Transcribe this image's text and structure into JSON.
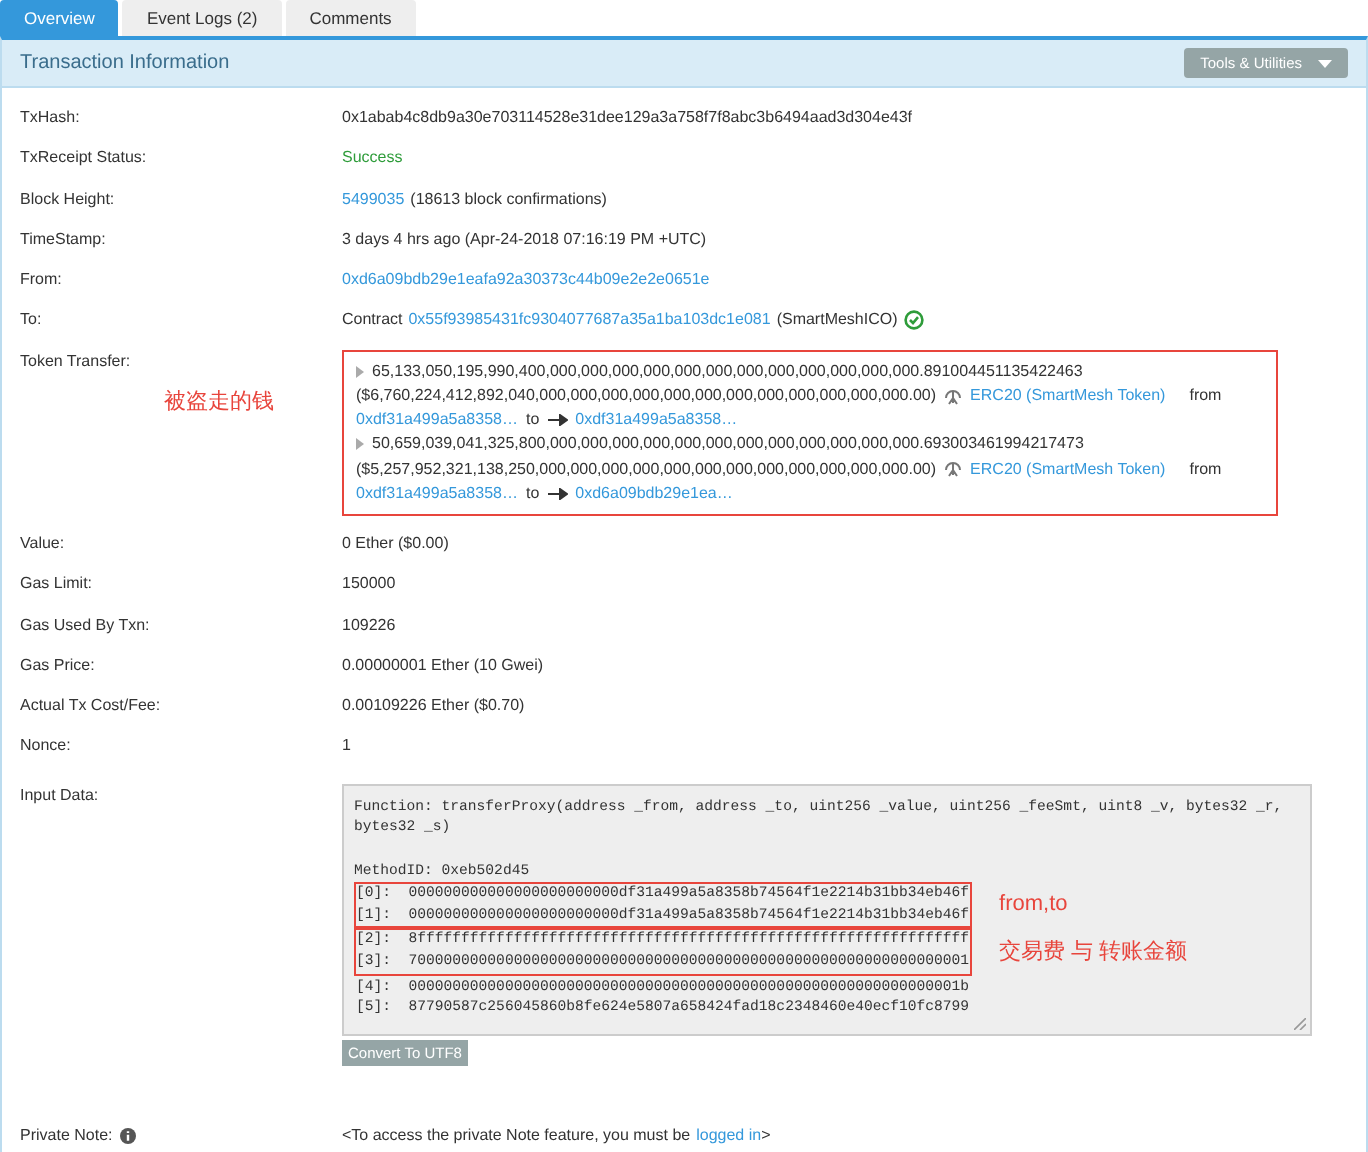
{
  "tabs": [
    {
      "label": "Overview",
      "selected": true
    },
    {
      "label": "Event Logs (2)",
      "selected": false
    },
    {
      "label": "Comments",
      "selected": false
    }
  ],
  "panel": {
    "title": "Transaction Information",
    "tools_button": "Tools & Utilities"
  },
  "rows_top": [
    {
      "label": "TxHash:",
      "parts": [
        {
          "kind": "text",
          "text": "0x1abab4c8db9a30e703114528e31dee129a3a758f7f8abc3b6494aad3d304e43f"
        }
      ]
    },
    {
      "label": "TxReceipt Status:",
      "parts": [
        {
          "kind": "success",
          "text": "Success"
        }
      ]
    },
    {
      "label": "Block Height:",
      "parts": [
        {
          "kind": "link",
          "text": "5499035"
        },
        {
          "kind": "text",
          "text": "(18613 block confirmations)"
        }
      ]
    },
    {
      "label": "TimeStamp:",
      "parts": [
        {
          "kind": "text",
          "text": "3 days 4 hrs ago (Apr-24-2018 07:16:19 PM +UTC)"
        }
      ]
    },
    {
      "label": "From:",
      "parts": [
        {
          "kind": "link",
          "text": "0xd6a09bdb29e1eafa92a30373c44b09e2e2e0651e"
        }
      ]
    },
    {
      "label": "To:",
      "parts": [
        {
          "kind": "text",
          "text": "Contract"
        },
        {
          "kind": "link",
          "text": "0x55f93985431fc9304077687a35a1ba103dc1e081"
        },
        {
          "kind": "text",
          "text": "(SmartMeshICO)"
        },
        {
          "kind": "verified"
        }
      ]
    }
  ],
  "token_transfer": {
    "label": "Token Transfer:",
    "annotation": "被盗走的钱",
    "transfers": [
      {
        "amount": "65,133,050,195,990,400,000,000,000,000,000,000,000,000,000,000,000,000.891004451135422463",
        "usd": "($6,760,224,412,892,040,000,000,000,000,000,000,000,000,000,000,000,000.00)",
        "token": "ERC20 (SmartMesh Token)",
        "from_word": "from",
        "from": "0xdf31a499a5a8358…",
        "to_word": "to",
        "to": "0xdf31a499a5a8358…"
      },
      {
        "amount": "50,659,039,041,325,800,000,000,000,000,000,000,000,000,000,000,000,000.693003461994217473",
        "usd": "($5,257,952,321,138,250,000,000,000,000,000,000,000,000,000,000,000,000.00)",
        "token": "ERC20 (SmartMesh Token)",
        "from_word": "from",
        "from": "0xdf31a499a5a8358…",
        "to_word": "to",
        "to": "0xd6a09bdb29e1ea…"
      }
    ]
  },
  "rows_mid": [
    {
      "label": "Value:",
      "parts": [
        {
          "kind": "text",
          "text": "0 Ether ($0.00)"
        }
      ]
    },
    {
      "label": "Gas Limit:",
      "parts": [
        {
          "kind": "text",
          "text": "150000"
        }
      ]
    },
    {
      "label": "Gas Used By Txn:",
      "parts": [
        {
          "kind": "text",
          "text": "109226"
        }
      ]
    },
    {
      "label": "Gas Price:",
      "parts": [
        {
          "kind": "text",
          "text": "0.00000001 Ether (10 Gwei)"
        }
      ]
    },
    {
      "label": "Actual Tx Cost/Fee:",
      "parts": [
        {
          "kind": "text",
          "text": "0.00109226 Ether ($0.70)"
        }
      ]
    },
    {
      "label": "Nonce:",
      "parts": [
        {
          "kind": "text",
          "text": "1"
        }
      ]
    }
  ],
  "input_data": {
    "label": "Input Data:",
    "function_lines": [
      "Function: transferProxy(address _from, address _to, uint256 _value, uint256 _feeSmt, uint8 _v, bytes32 _r,",
      "bytes32 _s)"
    ],
    "method_id": "MethodID: 0xeb502d45",
    "groups": [
      {
        "note": "from,to",
        "params": [
          {
            "index": "[0]:",
            "value": "000000000000000000000000df31a499a5a8358b74564f1e2214b31bb34eb46f"
          },
          {
            "index": "[1]:",
            "value": "000000000000000000000000df31a499a5a8358b74564f1e2214b31bb34eb46f"
          }
        ]
      },
      {
        "note": "交易费 与 转账金额",
        "params": [
          {
            "index": "[2]:",
            "value": "8fffffffffffffffffffffffffffffffffffffffffffffffffffffffffffffff"
          },
          {
            "index": "[3]:",
            "value": "7000000000000000000000000000000000000000000000000000000000000001"
          }
        ]
      },
      {
        "params": [
          {
            "index": "[4]:",
            "value": "000000000000000000000000000000000000000000000000000000000000001b"
          },
          {
            "index": "[5]:",
            "value": "87790587c256045860b8fe624e5807a658424fad18c2348460e40ecf10fc8799"
          }
        ]
      }
    ],
    "convert_button": "Convert To UTF8"
  },
  "private_note": {
    "label": "Private Note:",
    "text_before": "<To access the private Note feature, you must be",
    "link": "logged in",
    "text_after": ">"
  }
}
